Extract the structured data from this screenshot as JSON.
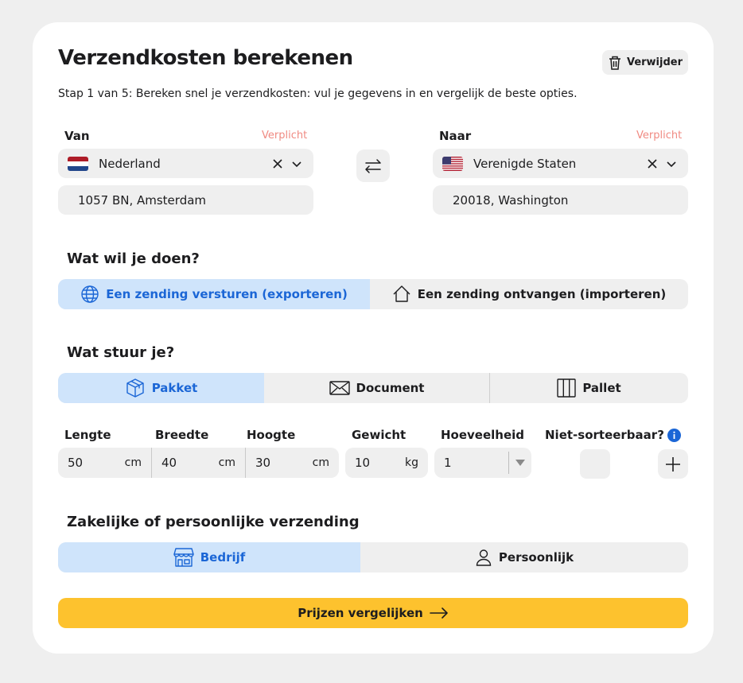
{
  "header": {
    "title": "Verzendkosten berekenen",
    "remove_label": "Verwijder",
    "subtitle": "Stap 1 van 5: Bereken snel je verzendkosten: vul je gegevens in en vergelijk de beste opties."
  },
  "from": {
    "label": "Van",
    "required": "Verplicht",
    "country": "Nederland",
    "address": "1057 BN, Amsterdam"
  },
  "to": {
    "label": "Naar",
    "required": "Verplicht",
    "country": "Verenigde Staten",
    "address": "20018, Washington"
  },
  "action": {
    "heading": "Wat wil je doen?",
    "options": [
      "Een zending versturen (exporteren)",
      "Een zending ontvangen (importeren)"
    ],
    "selected": 0
  },
  "shipment_type": {
    "heading": "Wat stuur je?",
    "options": [
      "Pakket",
      "Document",
      "Pallet"
    ],
    "selected": 0
  },
  "dimensions": {
    "length": {
      "label": "Lengte",
      "value": "50",
      "unit": "cm"
    },
    "width": {
      "label": "Breedte",
      "value": "40",
      "unit": "cm"
    },
    "height": {
      "label": "Hoogte",
      "value": "30",
      "unit": "cm"
    },
    "weight": {
      "label": "Gewicht",
      "value": "10",
      "unit": "kg"
    },
    "quantity": {
      "label": "Hoeveelheid",
      "value": "1"
    },
    "non_sortable": {
      "label": "Niet-sorteerbaar?",
      "checked": false
    }
  },
  "business": {
    "heading": "Zakelijke of persoonlijke verzending",
    "options": [
      "Bedrijf",
      "Persoonlijk"
    ],
    "selected": 0
  },
  "cta": {
    "label": "Prijzen vergelijken"
  },
  "colors": {
    "accent": "#1b66d6",
    "active_bg": "#cfe4fb",
    "cta": "#fdc22e",
    "required": "#f08a82"
  }
}
